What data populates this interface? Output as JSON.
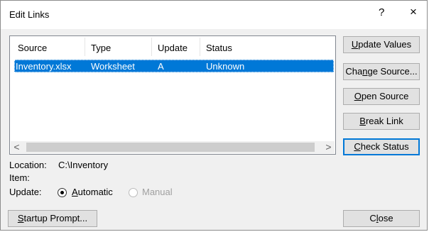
{
  "window": {
    "title": "Edit Links",
    "help_glyph": "?",
    "close_glyph": "×"
  },
  "links_table": {
    "columns": [
      "Source",
      "Type",
      "Update",
      "Status"
    ],
    "rows": [
      {
        "source": "Inventory.xlsx",
        "type": "Worksheet",
        "update": "A",
        "status": "Unknown"
      }
    ],
    "scroll_left_glyph": "<",
    "scroll_right_glyph": ">"
  },
  "buttons": {
    "update_values": {
      "pre": "",
      "key": "U",
      "post": "pdate Values"
    },
    "change_source": {
      "pre": "Cha",
      "key": "n",
      "post": "ge Source..."
    },
    "open_source": {
      "pre": "",
      "key": "O",
      "post": "pen Source"
    },
    "break_link": {
      "pre": "",
      "key": "B",
      "post": "reak Link"
    },
    "check_status": {
      "pre": "",
      "key": "C",
      "post": "heck Status"
    },
    "startup_prompt": {
      "pre": "",
      "key": "S",
      "post": "tartup Prompt..."
    },
    "close": {
      "pre": "C",
      "key": "l",
      "post": "ose"
    }
  },
  "details": {
    "location_label": "Location:",
    "location_value": "C:\\Inventory",
    "item_label": "Item:",
    "update_label": "Update:",
    "automatic": {
      "pre": "",
      "key": "A",
      "post": "utomatic"
    },
    "manual_label": "Manual",
    "selected_mode": "Automatic"
  },
  "colors": {
    "selection": "#0078d7",
    "default_button_border": "#0078d7"
  }
}
